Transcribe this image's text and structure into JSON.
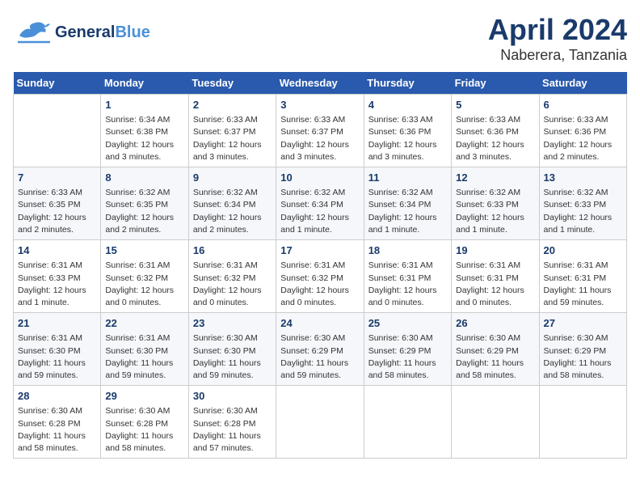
{
  "app": {
    "logo_general": "General",
    "logo_blue": "Blue",
    "title": "April 2024",
    "subtitle": "Naberera, Tanzania"
  },
  "calendar": {
    "days_of_week": [
      "Sunday",
      "Monday",
      "Tuesday",
      "Wednesday",
      "Thursday",
      "Friday",
      "Saturday"
    ],
    "weeks": [
      [
        {
          "day": "",
          "info": ""
        },
        {
          "day": "1",
          "info": "Sunrise: 6:34 AM\nSunset: 6:38 PM\nDaylight: 12 hours\nand 3 minutes."
        },
        {
          "day": "2",
          "info": "Sunrise: 6:33 AM\nSunset: 6:37 PM\nDaylight: 12 hours\nand 3 minutes."
        },
        {
          "day": "3",
          "info": "Sunrise: 6:33 AM\nSunset: 6:37 PM\nDaylight: 12 hours\nand 3 minutes."
        },
        {
          "day": "4",
          "info": "Sunrise: 6:33 AM\nSunset: 6:36 PM\nDaylight: 12 hours\nand 3 minutes."
        },
        {
          "day": "5",
          "info": "Sunrise: 6:33 AM\nSunset: 6:36 PM\nDaylight: 12 hours\nand 3 minutes."
        },
        {
          "day": "6",
          "info": "Sunrise: 6:33 AM\nSunset: 6:36 PM\nDaylight: 12 hours\nand 2 minutes."
        }
      ],
      [
        {
          "day": "7",
          "info": "Sunrise: 6:33 AM\nSunset: 6:35 PM\nDaylight: 12 hours\nand 2 minutes."
        },
        {
          "day": "8",
          "info": "Sunrise: 6:32 AM\nSunset: 6:35 PM\nDaylight: 12 hours\nand 2 minutes."
        },
        {
          "day": "9",
          "info": "Sunrise: 6:32 AM\nSunset: 6:34 PM\nDaylight: 12 hours\nand 2 minutes."
        },
        {
          "day": "10",
          "info": "Sunrise: 6:32 AM\nSunset: 6:34 PM\nDaylight: 12 hours\nand 1 minute."
        },
        {
          "day": "11",
          "info": "Sunrise: 6:32 AM\nSunset: 6:34 PM\nDaylight: 12 hours\nand 1 minute."
        },
        {
          "day": "12",
          "info": "Sunrise: 6:32 AM\nSunset: 6:33 PM\nDaylight: 12 hours\nand 1 minute."
        },
        {
          "day": "13",
          "info": "Sunrise: 6:32 AM\nSunset: 6:33 PM\nDaylight: 12 hours\nand 1 minute."
        }
      ],
      [
        {
          "day": "14",
          "info": "Sunrise: 6:31 AM\nSunset: 6:33 PM\nDaylight: 12 hours\nand 1 minute."
        },
        {
          "day": "15",
          "info": "Sunrise: 6:31 AM\nSunset: 6:32 PM\nDaylight: 12 hours\nand 0 minutes."
        },
        {
          "day": "16",
          "info": "Sunrise: 6:31 AM\nSunset: 6:32 PM\nDaylight: 12 hours\nand 0 minutes."
        },
        {
          "day": "17",
          "info": "Sunrise: 6:31 AM\nSunset: 6:32 PM\nDaylight: 12 hours\nand 0 minutes."
        },
        {
          "day": "18",
          "info": "Sunrise: 6:31 AM\nSunset: 6:31 PM\nDaylight: 12 hours\nand 0 minutes."
        },
        {
          "day": "19",
          "info": "Sunrise: 6:31 AM\nSunset: 6:31 PM\nDaylight: 12 hours\nand 0 minutes."
        },
        {
          "day": "20",
          "info": "Sunrise: 6:31 AM\nSunset: 6:31 PM\nDaylight: 11 hours\nand 59 minutes."
        }
      ],
      [
        {
          "day": "21",
          "info": "Sunrise: 6:31 AM\nSunset: 6:30 PM\nDaylight: 11 hours\nand 59 minutes."
        },
        {
          "day": "22",
          "info": "Sunrise: 6:31 AM\nSunset: 6:30 PM\nDaylight: 11 hours\nand 59 minutes."
        },
        {
          "day": "23",
          "info": "Sunrise: 6:30 AM\nSunset: 6:30 PM\nDaylight: 11 hours\nand 59 minutes."
        },
        {
          "day": "24",
          "info": "Sunrise: 6:30 AM\nSunset: 6:29 PM\nDaylight: 11 hours\nand 59 minutes."
        },
        {
          "day": "25",
          "info": "Sunrise: 6:30 AM\nSunset: 6:29 PM\nDaylight: 11 hours\nand 58 minutes."
        },
        {
          "day": "26",
          "info": "Sunrise: 6:30 AM\nSunset: 6:29 PM\nDaylight: 11 hours\nand 58 minutes."
        },
        {
          "day": "27",
          "info": "Sunrise: 6:30 AM\nSunset: 6:29 PM\nDaylight: 11 hours\nand 58 minutes."
        }
      ],
      [
        {
          "day": "28",
          "info": "Sunrise: 6:30 AM\nSunset: 6:28 PM\nDaylight: 11 hours\nand 58 minutes."
        },
        {
          "day": "29",
          "info": "Sunrise: 6:30 AM\nSunset: 6:28 PM\nDaylight: 11 hours\nand 58 minutes."
        },
        {
          "day": "30",
          "info": "Sunrise: 6:30 AM\nSunset: 6:28 PM\nDaylight: 11 hours\nand 57 minutes."
        },
        {
          "day": "",
          "info": ""
        },
        {
          "day": "",
          "info": ""
        },
        {
          "day": "",
          "info": ""
        },
        {
          "day": "",
          "info": ""
        }
      ]
    ]
  }
}
